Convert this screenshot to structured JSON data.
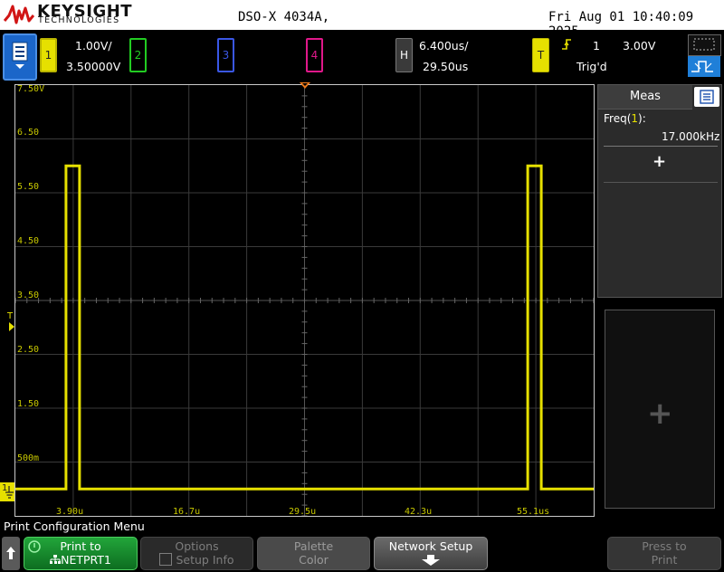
{
  "header": {
    "brand_name": "KEYSIGHT",
    "brand_sub": "TECHNOLOGIES",
    "model": "DSO-X 4034A,",
    "datetime": "Fri Aug 01 10:40:09 2025"
  },
  "channels": {
    "ch1": {
      "number": "1",
      "scale": "1.00V/",
      "offset": "3.50000V",
      "color": "#e6e000"
    },
    "ch2": {
      "number": "2",
      "color": "#22cc22"
    },
    "ch3": {
      "number": "3",
      "color": "#3a57e6"
    },
    "ch4": {
      "number": "4",
      "color": "#e0188a"
    }
  },
  "horizontal": {
    "label": "H",
    "timebase": "6.400us/",
    "delay": "29.50us"
  },
  "trigger": {
    "label": "T",
    "source": "1",
    "level": "3.00V",
    "status": "Trig'd"
  },
  "grid": {
    "volt_labels": [
      "7.50V",
      "6.50",
      "5.50",
      "4.50",
      "3.50",
      "2.50",
      "1.50",
      "500m"
    ],
    "time_labels": [
      "3.90u",
      "16.7u",
      "29.5u",
      "42.3u",
      "55.1us"
    ],
    "trigger_marker": "T",
    "ground_marker": "1"
  },
  "waveform": {
    "low_level_v": 0.0,
    "high_level_v": 6.0,
    "rising_edges_us": [
      3.1,
      54.2
    ],
    "falling_edges_us": [
      4.6,
      55.7
    ],
    "time_start_us": -2.5,
    "time_end_us": 61.5,
    "volt_top": 7.5,
    "volt_bottom": -0.5
  },
  "meas": {
    "tab_label": "Meas",
    "item_label_prefix": "Freq(",
    "item_channel": "1",
    "item_label_suffix": "):",
    "item_value": "17.000kHz",
    "add_symbol": "+"
  },
  "softkeys": {
    "menu_title": "Print Configuration Menu",
    "print_to": {
      "line1": "Print to",
      "line2": "NETPRT1"
    },
    "options": {
      "line1": "Options",
      "line2": "Setup Info"
    },
    "palette": {
      "line1": "Palette",
      "line2": "Color"
    },
    "network": {
      "line1": "Network Setup"
    },
    "press_to": {
      "line1": "Press to",
      "line2": "Print"
    }
  },
  "icons": [
    "keysight-logo-icon",
    "main-menu-icon",
    "zoom-icon",
    "trigger-edge-icon",
    "back-arrow-icon",
    "network-icon",
    "down-arrow-icon",
    "checkbox-icon"
  ]
}
